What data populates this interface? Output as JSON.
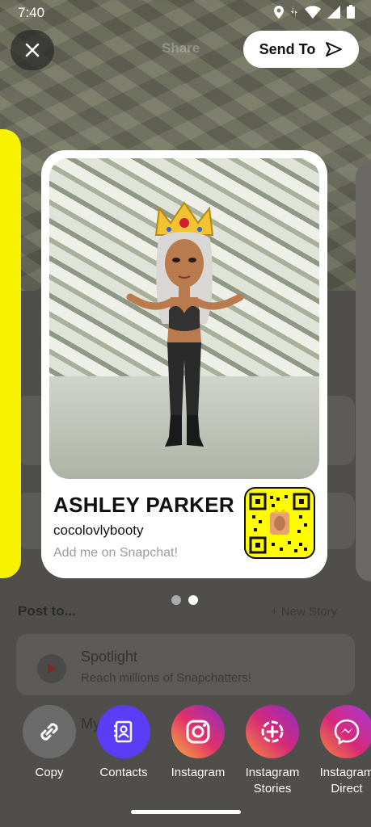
{
  "status_bar": {
    "time": "7:40"
  },
  "top": {
    "share_label": "Share",
    "send_to_label": "Send To"
  },
  "card": {
    "display_name": "ASHLEY PARKER",
    "username": "cocolovlybooty",
    "cta": "Add me on Snapchat!"
  },
  "pager": {
    "page_count": 2,
    "active_page": 2
  },
  "background": {
    "post_to_label": "Post to...",
    "new_story_label": "+ New Story",
    "spotlight_title": "Spotlight",
    "spotlight_subtitle": "Reach millions of Snapchatters!",
    "my_story_partial": "My"
  },
  "share_targets": [
    {
      "label": "Copy",
      "icon": "link-icon",
      "color": "#6b6b6b"
    },
    {
      "label": "Contacts",
      "icon": "contacts-icon",
      "color": "#5a3df5"
    },
    {
      "label": "Instagram",
      "icon": "instagram-icon",
      "color": "#d6297a"
    },
    {
      "label": "Instagram Stories",
      "icon": "instagram-stories-icon",
      "color": "#b02fc7"
    },
    {
      "label": "Instagram Direct",
      "icon": "messenger-icon",
      "color": "#c935d8"
    }
  ],
  "colors": {
    "snap_yellow": "#fffc00",
    "send_button_bg": "#ffffff"
  }
}
